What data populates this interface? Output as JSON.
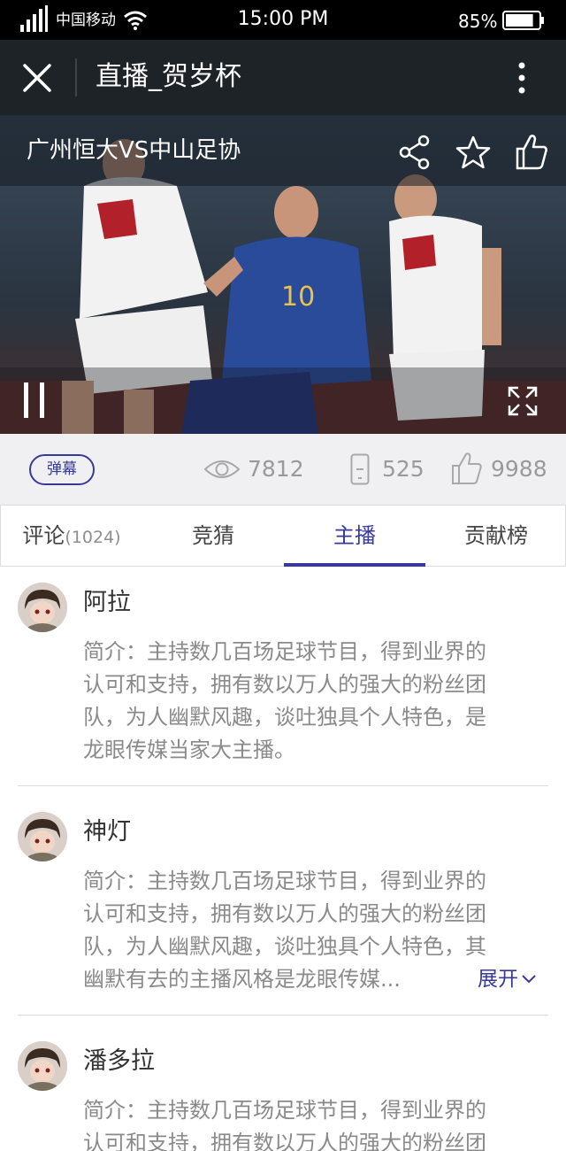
{
  "status_bar": {
    "carrier": "中国移动",
    "time": "15:00 PM",
    "battery": "85%",
    "battery_level": 0.85
  },
  "app_bar": {
    "title": "直播_贺岁杯"
  },
  "video": {
    "match_title": "广州恒大VS中山足协"
  },
  "stats": {
    "danmu_label": "弹幕",
    "views": "7812",
    "phone_count": "525",
    "likes": "9988"
  },
  "tabs": [
    {
      "label": "评论",
      "count": "(1024)"
    },
    {
      "label": "竞猜"
    },
    {
      "label": "主播"
    },
    {
      "label": "贡献榜"
    }
  ],
  "active_tab": 2,
  "hosts": [
    {
      "name": "阿拉",
      "desc_lines": [
        "简介：主持数几百场足球节目，得到业界的",
        "认可和支持，拥有数以万人的强大的粉丝团",
        "队，为人幽默风趣，谈吐独具个人特色，是",
        "龙眼传媒当家大主播。"
      ]
    },
    {
      "name": "神灯",
      "desc_lines": [
        "简介：主持数几百场足球节目，得到业界的",
        "认可和支持，拥有数以万人的强大的粉丝团",
        "队，为人幽默风趣，谈吐独具个人特色，其",
        "幽默有去的主播风格是龙眼传媒..."
      ],
      "expand_label": "展开"
    },
    {
      "name": "潘多拉",
      "desc_lines": [
        "简介：主持数几百场足球节目，得到业界的",
        "认可和支持，拥有数以万人的强大的粉丝团"
      ]
    }
  ]
}
